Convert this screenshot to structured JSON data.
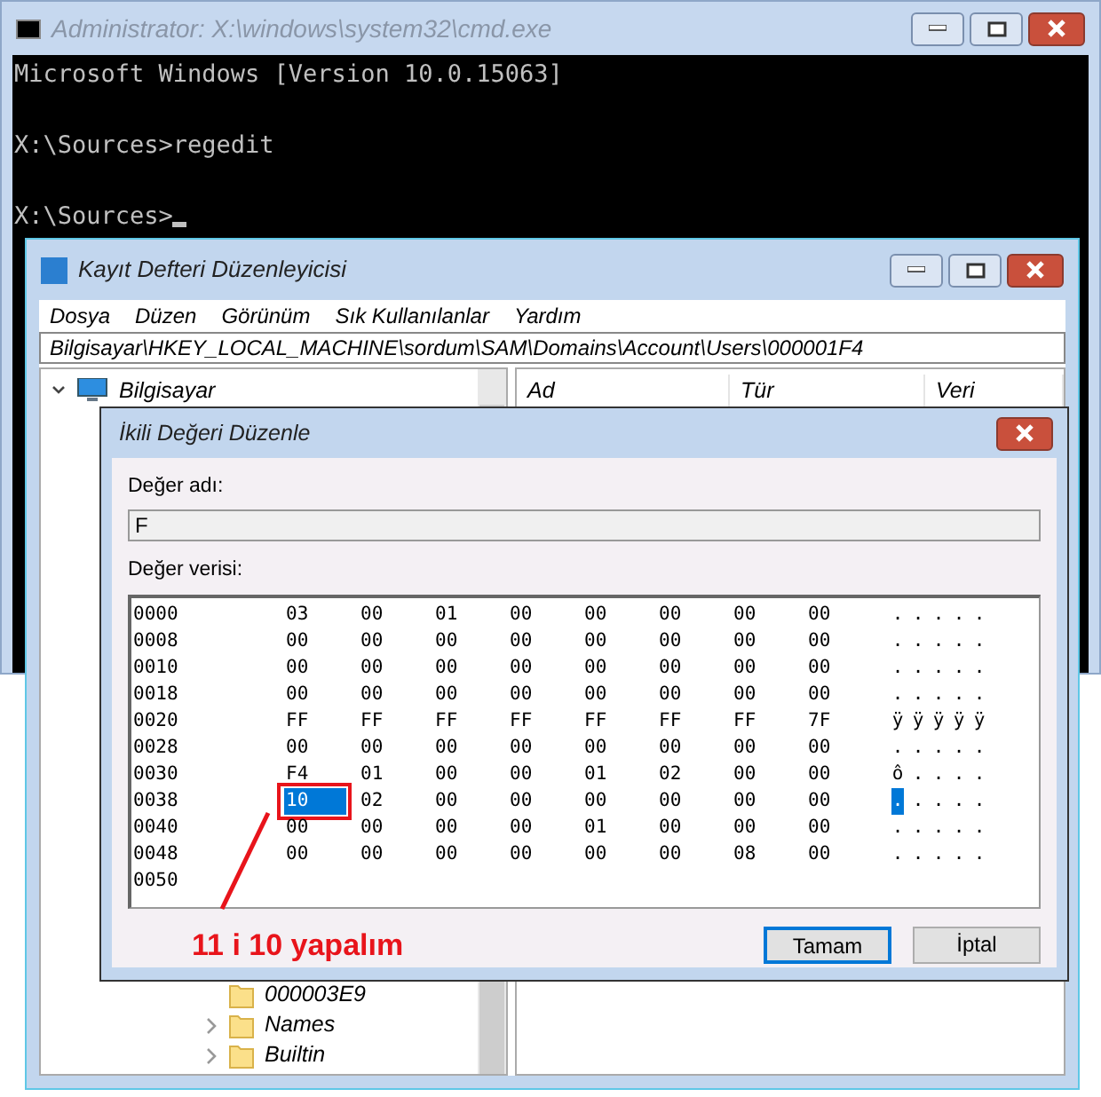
{
  "console_window": {
    "title": "Administrator: X:\\windows\\system32\\cmd.exe",
    "lines": [
      {
        "text": "Microsoft Windows [Version 10.0.15063]",
        "cursor": false
      },
      {
        "text": "X:\\Sources>regedit",
        "cursor": false
      },
      {
        "text": "X:\\Sources>",
        "cursor": true
      }
    ]
  },
  "registry_window": {
    "title": "Kayıt Defteri Düzenleyicisi",
    "menu": [
      "Dosya",
      "Düzen",
      "Görünüm",
      "Sık Kullanılanlar",
      "Yardım"
    ],
    "address": "Bilgisayar\\HKEY_LOCAL_MACHINE\\sordum\\SAM\\Domains\\Account\\Users\\000001F4",
    "tree": [
      {
        "label": "Bilgisayar",
        "expanded": true,
        "children": [
          {
            "label": "000003E9"
          },
          {
            "label": "Names",
            "expanded": false
          },
          {
            "label": "Builtin",
            "expanded": false
          }
        ]
      }
    ],
    "columns": [
      "Ad",
      "Tür",
      "Veri"
    ]
  },
  "edit_dialog": {
    "title": "İkili Değeri Düzenle",
    "name_label": "Değer adı:",
    "name_value": "F",
    "data_label": "Değer verisi:",
    "hex_rows": [
      {
        "address": "0000",
        "bytes": [
          {
            "value": "03",
            "selected": false
          },
          {
            "value": "00",
            "selected": false
          },
          {
            "value": "01",
            "selected": false
          },
          {
            "value": "00",
            "selected": false
          },
          {
            "value": "00",
            "selected": false
          },
          {
            "value": "00",
            "selected": false
          },
          {
            "value": "00",
            "selected": false
          },
          {
            "value": "00",
            "selected": false
          }
        ],
        "ascii": [
          ".",
          ".",
          ".",
          ".",
          "."
        ]
      },
      {
        "address": "0008",
        "bytes": [
          {
            "value": "00",
            "selected": false
          },
          {
            "value": "00",
            "selected": false
          },
          {
            "value": "00",
            "selected": false
          },
          {
            "value": "00",
            "selected": false
          },
          {
            "value": "00",
            "selected": false
          },
          {
            "value": "00",
            "selected": false
          },
          {
            "value": "00",
            "selected": false
          },
          {
            "value": "00",
            "selected": false
          }
        ],
        "ascii": [
          ".",
          ".",
          ".",
          ".",
          "."
        ]
      },
      {
        "address": "0010",
        "bytes": [
          {
            "value": "00",
            "selected": false
          },
          {
            "value": "00",
            "selected": false
          },
          {
            "value": "00",
            "selected": false
          },
          {
            "value": "00",
            "selected": false
          },
          {
            "value": "00",
            "selected": false
          },
          {
            "value": "00",
            "selected": false
          },
          {
            "value": "00",
            "selected": false
          },
          {
            "value": "00",
            "selected": false
          }
        ],
        "ascii": [
          ".",
          ".",
          ".",
          ".",
          "."
        ]
      },
      {
        "address": "0018",
        "bytes": [
          {
            "value": "00",
            "selected": false
          },
          {
            "value": "00",
            "selected": false
          },
          {
            "value": "00",
            "selected": false
          },
          {
            "value": "00",
            "selected": false
          },
          {
            "value": "00",
            "selected": false
          },
          {
            "value": "00",
            "selected": false
          },
          {
            "value": "00",
            "selected": false
          },
          {
            "value": "00",
            "selected": false
          }
        ],
        "ascii": [
          ".",
          ".",
          ".",
          ".",
          "."
        ]
      },
      {
        "address": "0020",
        "bytes": [
          {
            "value": "FF",
            "selected": false
          },
          {
            "value": "FF",
            "selected": false
          },
          {
            "value": "FF",
            "selected": false
          },
          {
            "value": "FF",
            "selected": false
          },
          {
            "value": "FF",
            "selected": false
          },
          {
            "value": "FF",
            "selected": false
          },
          {
            "value": "FF",
            "selected": false
          },
          {
            "value": "7F",
            "selected": false
          }
        ],
        "ascii": [
          "ÿ",
          "ÿ",
          "ÿ",
          "ÿ",
          "ÿ"
        ]
      },
      {
        "address": "0028",
        "bytes": [
          {
            "value": "00",
            "selected": false
          },
          {
            "value": "00",
            "selected": false
          },
          {
            "value": "00",
            "selected": false
          },
          {
            "value": "00",
            "selected": false
          },
          {
            "value": "00",
            "selected": false
          },
          {
            "value": "00",
            "selected": false
          },
          {
            "value": "00",
            "selected": false
          },
          {
            "value": "00",
            "selected": false
          }
        ],
        "ascii": [
          ".",
          ".",
          ".",
          ".",
          "."
        ]
      },
      {
        "address": "0030",
        "bytes": [
          {
            "value": "F4",
            "selected": false
          },
          {
            "value": "01",
            "selected": false
          },
          {
            "value": "00",
            "selected": false
          },
          {
            "value": "00",
            "selected": false
          },
          {
            "value": "01",
            "selected": false
          },
          {
            "value": "02",
            "selected": false
          },
          {
            "value": "00",
            "selected": false
          },
          {
            "value": "00",
            "selected": false
          }
        ],
        "ascii": [
          "ô",
          ".",
          ".",
          ".",
          "."
        ]
      },
      {
        "address": "0038",
        "bytes": [
          {
            "value": "10",
            "selected": true
          },
          {
            "value": "02",
            "selected": false
          },
          {
            "value": "00",
            "selected": false
          },
          {
            "value": "00",
            "selected": false
          },
          {
            "value": "00",
            "selected": false
          },
          {
            "value": "00",
            "selected": false
          },
          {
            "value": "00",
            "selected": false
          },
          {
            "value": "00",
            "selected": false
          }
        ],
        "ascii": [
          ".",
          ".",
          ".",
          ".",
          "."
        ]
      },
      {
        "address": "0040",
        "bytes": [
          {
            "value": "00",
            "selected": false
          },
          {
            "value": "00",
            "selected": false
          },
          {
            "value": "00",
            "selected": false
          },
          {
            "value": "00",
            "selected": false
          },
          {
            "value": "01",
            "selected": false
          },
          {
            "value": "00",
            "selected": false
          },
          {
            "value": "00",
            "selected": false
          },
          {
            "value": "00",
            "selected": false
          }
        ],
        "ascii": [
          ".",
          ".",
          ".",
          ".",
          "."
        ]
      },
      {
        "address": "0048",
        "bytes": [
          {
            "value": "00",
            "selected": false
          },
          {
            "value": "00",
            "selected": false
          },
          {
            "value": "00",
            "selected": false
          },
          {
            "value": "00",
            "selected": false
          },
          {
            "value": "00",
            "selected": false
          },
          {
            "value": "00",
            "selected": false
          },
          {
            "value": "08",
            "selected": false
          },
          {
            "value": "00",
            "selected": false
          }
        ],
        "ascii": [
          ".",
          ".",
          ".",
          ".",
          "."
        ]
      },
      {
        "address": "0050",
        "bytes": [],
        "ascii": []
      }
    ],
    "annotation": "11 i 10 yapalım",
    "buttons": [
      {
        "label": "Tamam",
        "default": true
      },
      {
        "label": "İptal",
        "default": false
      }
    ]
  }
}
